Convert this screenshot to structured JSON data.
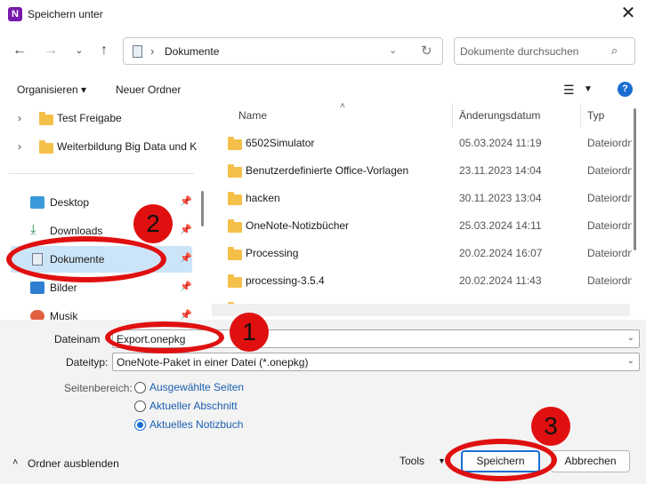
{
  "window": {
    "title": "Speichern unter",
    "app_icon": "onenote-icon",
    "close": "✕"
  },
  "address": {
    "path_sep": "›",
    "current": "Dokumente"
  },
  "search": {
    "placeholder": "Dokumente durchsuchen"
  },
  "toolbar": {
    "organize": "Organisieren ▾",
    "new_folder": "Neuer Ordner"
  },
  "tree": [
    {
      "label": "Test Freigabe"
    },
    {
      "label": "Weiterbildung Big Data und K"
    }
  ],
  "quick_access": [
    {
      "label": "Desktop",
      "icon": "desktop-icon"
    },
    {
      "label": "Downloads",
      "icon": "download-icon"
    },
    {
      "label": "Dokumente",
      "icon": "document-icon",
      "selected": true
    },
    {
      "label": "Bilder",
      "icon": "pictures-icon"
    },
    {
      "label": "Musik",
      "icon": "music-icon"
    }
  ],
  "columns": {
    "name": "Name",
    "date": "Änderungsdatum",
    "type": "Typ"
  },
  "files": [
    {
      "name": "6502Simulator",
      "date": "05.03.2024 11:19",
      "type": "Dateiordn"
    },
    {
      "name": "Benutzerdefinierte Office-Vorlagen",
      "date": "23.11.2023 14:04",
      "type": "Dateiordn"
    },
    {
      "name": "hacken",
      "date": "30.11.2023 13:04",
      "type": "Dateiordn"
    },
    {
      "name": "OneNote-Notizbücher",
      "date": "25.03.2024 14:11",
      "type": "Dateiordn"
    },
    {
      "name": "Processing",
      "date": "20.02.2024 16:07",
      "type": "Dateiordn"
    },
    {
      "name": "processing-3.5.4",
      "date": "20.02.2024 11:43",
      "type": "Dateiordn"
    }
  ],
  "form": {
    "filename_label": "Dateinam",
    "filename_value": "Export.onepkg",
    "filetype_label": "Dateityp:",
    "filetype_value": "OneNote-Paket in einer Datei (*.onepkg)",
    "range_label": "Seitenbereich:",
    "range_options": [
      {
        "label": "Ausgewählte Seiten",
        "checked": false
      },
      {
        "label": "Aktueller Abschnitt",
        "checked": false
      },
      {
        "label": "Aktuelles Notizbuch",
        "checked": true
      }
    ]
  },
  "footer": {
    "hide_folders": "Ordner ausblenden",
    "tools": "Tools",
    "save": "Speichern",
    "cancel": "Abbrechen"
  },
  "annotations": [
    "2",
    "1",
    "3"
  ],
  "colors": {
    "accent": "#1b6ed1",
    "annotation": "#e01010",
    "selected_bg": "#cce4f7",
    "folder": "#f5c04a"
  }
}
